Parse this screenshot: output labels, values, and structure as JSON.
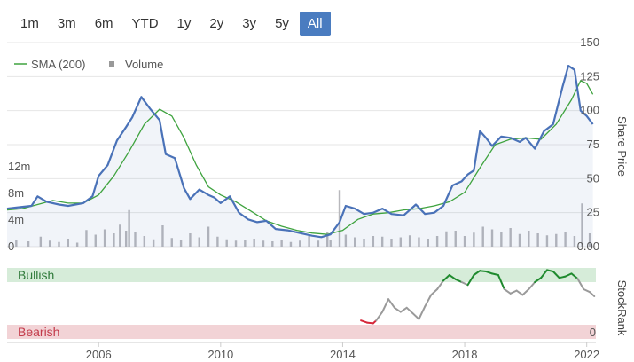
{
  "range_selector": {
    "buttons": [
      "1m",
      "3m",
      "6m",
      "YTD",
      "1y",
      "2y",
      "3y",
      "5y",
      "All"
    ],
    "active": "All"
  },
  "colors": {
    "price": "#4a72b8",
    "sma": "#3fa33f",
    "volume": "#b8b8bc",
    "bullish_band": "#d6ecd9",
    "bearish_band": "#f2d3d6",
    "rank_neutral": "#9a9a9a",
    "rank_bullish": "#1f8a2e",
    "rank_bearish": "#d6283a"
  },
  "chart_data": [
    {
      "type": "line",
      "name": "price-chart",
      "legend": [
        {
          "name": "SMA (200)",
          "kind": "line"
        },
        {
          "name": "Volume",
          "kind": "square"
        }
      ],
      "legend_position": "top-left",
      "ylabel": "Share Price",
      "y_ticks": [
        "0.00",
        "25",
        "50",
        "75",
        "100",
        "125",
        "150"
      ],
      "ylim": [
        0,
        150
      ],
      "vol_ticks": [
        "0",
        "4m",
        "8m",
        "12m"
      ],
      "vol_lim": [
        0,
        16
      ],
      "xlim": [
        2003.0,
        2022.3
      ],
      "x_ticks": [
        "2006",
        "2010",
        "2014",
        "2018",
        "2022"
      ],
      "series": [
        {
          "name": "Share Price",
          "points": [
            [
              2003.0,
              28
            ],
            [
              2003.4,
              29
            ],
            [
              2003.8,
              30
            ],
            [
              2004.0,
              37
            ],
            [
              2004.3,
              33
            ],
            [
              2004.7,
              31
            ],
            [
              2005.0,
              30
            ],
            [
              2005.5,
              32
            ],
            [
              2005.8,
              37
            ],
            [
              2006.0,
              52
            ],
            [
              2006.3,
              60
            ],
            [
              2006.6,
              78
            ],
            [
              2006.9,
              88
            ],
            [
              2007.1,
              95
            ],
            [
              2007.4,
              110
            ],
            [
              2007.7,
              101
            ],
            [
              2008.0,
              93
            ],
            [
              2008.2,
              68
            ],
            [
              2008.5,
              65
            ],
            [
              2008.8,
              43
            ],
            [
              2009.0,
              35
            ],
            [
              2009.3,
              42
            ],
            [
              2009.6,
              38
            ],
            [
              2009.8,
              36
            ],
            [
              2010.0,
              32
            ],
            [
              2010.3,
              37
            ],
            [
              2010.6,
              25
            ],
            [
              2010.9,
              20
            ],
            [
              2011.2,
              18
            ],
            [
              2011.5,
              19
            ],
            [
              2011.8,
              13
            ],
            [
              2012.2,
              12
            ],
            [
              2012.6,
              10
            ],
            [
              2013.0,
              8
            ],
            [
              2013.3,
              7
            ],
            [
              2013.6,
              9
            ],
            [
              2013.9,
              18
            ],
            [
              2014.1,
              30
            ],
            [
              2014.4,
              28
            ],
            [
              2014.7,
              24
            ],
            [
              2015.0,
              25
            ],
            [
              2015.3,
              28
            ],
            [
              2015.6,
              24
            ],
            [
              2016.0,
              23
            ],
            [
              2016.4,
              31
            ],
            [
              2016.7,
              24
            ],
            [
              2017.0,
              25
            ],
            [
              2017.3,
              30
            ],
            [
              2017.6,
              45
            ],
            [
              2017.9,
              48
            ],
            [
              2018.1,
              53
            ],
            [
              2018.3,
              56
            ],
            [
              2018.5,
              85
            ],
            [
              2018.7,
              80
            ],
            [
              2018.9,
              74
            ],
            [
              2019.2,
              81
            ],
            [
              2019.5,
              80
            ],
            [
              2019.8,
              77
            ],
            [
              2020.0,
              80
            ],
            [
              2020.3,
              72
            ],
            [
              2020.6,
              85
            ],
            [
              2020.9,
              90
            ],
            [
              2021.2,
              117
            ],
            [
              2021.4,
              133
            ],
            [
              2021.6,
              130
            ],
            [
              2021.8,
              100
            ],
            [
              2022.0,
              96
            ],
            [
              2022.2,
              90
            ]
          ]
        },
        {
          "name": "SMA (200)",
          "points": [
            [
              2003.0,
              27
            ],
            [
              2003.5,
              28
            ],
            [
              2004.0,
              31
            ],
            [
              2004.5,
              34
            ],
            [
              2005.0,
              32
            ],
            [
              2005.5,
              32
            ],
            [
              2006.0,
              38
            ],
            [
              2006.5,
              52
            ],
            [
              2007.0,
              70
            ],
            [
              2007.5,
              90
            ],
            [
              2008.0,
              101
            ],
            [
              2008.4,
              96
            ],
            [
              2008.8,
              80
            ],
            [
              2009.2,
              60
            ],
            [
              2009.6,
              44
            ],
            [
              2010.0,
              38
            ],
            [
              2010.5,
              33
            ],
            [
              2011.0,
              26
            ],
            [
              2011.5,
              19
            ],
            [
              2012.0,
              15
            ],
            [
              2012.5,
              12
            ],
            [
              2013.0,
              10
            ],
            [
              2013.5,
              9
            ],
            [
              2014.0,
              12
            ],
            [
              2014.5,
              20
            ],
            [
              2015.0,
              24
            ],
            [
              2015.5,
              25
            ],
            [
              2016.0,
              27
            ],
            [
              2016.5,
              28
            ],
            [
              2017.0,
              30
            ],
            [
              2017.5,
              33
            ],
            [
              2018.0,
              40
            ],
            [
              2018.5,
              58
            ],
            [
              2019.0,
              75
            ],
            [
              2019.5,
              79
            ],
            [
              2020.0,
              80
            ],
            [
              2020.5,
              79
            ],
            [
              2021.0,
              90
            ],
            [
              2021.5,
              108
            ],
            [
              2021.8,
              122
            ],
            [
              2022.0,
              120
            ],
            [
              2022.2,
              112
            ]
          ]
        }
      ],
      "volume_bars": [
        [
          2003.3,
          1.0
        ],
        [
          2003.7,
          0.8
        ],
        [
          2004.1,
          1.5
        ],
        [
          2004.4,
          0.9
        ],
        [
          2004.7,
          0.7
        ],
        [
          2005.0,
          1.2
        ],
        [
          2005.3,
          0.6
        ],
        [
          2005.6,
          2.5
        ],
        [
          2005.9,
          1.8
        ],
        [
          2006.2,
          2.6
        ],
        [
          2006.5,
          2.0
        ],
        [
          2006.7,
          3.3
        ],
        [
          2006.9,
          2.4
        ],
        [
          2007.0,
          5.5
        ],
        [
          2007.2,
          2.2
        ],
        [
          2007.5,
          1.6
        ],
        [
          2007.8,
          1.1
        ],
        [
          2008.1,
          3.2
        ],
        [
          2008.4,
          1.3
        ],
        [
          2008.7,
          1.0
        ],
        [
          2009.0,
          2.0
        ],
        [
          2009.3,
          1.4
        ],
        [
          2009.6,
          3.0
        ],
        [
          2009.9,
          1.5
        ],
        [
          2010.2,
          1.1
        ],
        [
          2010.5,
          0.9
        ],
        [
          2010.8,
          1.0
        ],
        [
          2011.1,
          1.2
        ],
        [
          2011.4,
          0.9
        ],
        [
          2011.7,
          0.8
        ],
        [
          2012.0,
          1.0
        ],
        [
          2012.3,
          0.7
        ],
        [
          2012.6,
          0.9
        ],
        [
          2012.9,
          1.6
        ],
        [
          2013.2,
          0.9
        ],
        [
          2013.5,
          2.2
        ],
        [
          2013.6,
          1.0
        ],
        [
          2013.9,
          8.5
        ],
        [
          2014.1,
          1.8
        ],
        [
          2014.4,
          1.4
        ],
        [
          2014.7,
          1.2
        ],
        [
          2015.0,
          1.6
        ],
        [
          2015.3,
          1.5
        ],
        [
          2015.6,
          1.2
        ],
        [
          2015.9,
          1.4
        ],
        [
          2016.2,
          1.7
        ],
        [
          2016.5,
          1.4
        ],
        [
          2016.8,
          1.2
        ],
        [
          2017.1,
          1.6
        ],
        [
          2017.4,
          2.3
        ],
        [
          2017.7,
          2.4
        ],
        [
          2018.0,
          1.6
        ],
        [
          2018.3,
          2.1
        ],
        [
          2018.6,
          3.0
        ],
        [
          2018.9,
          2.6
        ],
        [
          2019.2,
          2.2
        ],
        [
          2019.5,
          2.8
        ],
        [
          2019.8,
          1.9
        ],
        [
          2020.1,
          2.4
        ],
        [
          2020.4,
          2.0
        ],
        [
          2020.7,
          1.7
        ],
        [
          2021.0,
          1.9
        ],
        [
          2021.3,
          2.2
        ],
        [
          2021.6,
          1.6
        ],
        [
          2021.85,
          6.5
        ],
        [
          2022.1,
          2.0
        ]
      ]
    },
    {
      "type": "line",
      "name": "stockrank-chart",
      "ylabel": "StockRank",
      "y_ticks": [
        "0"
      ],
      "ylim": [
        0,
        100
      ],
      "zones": [
        {
          "label": "Bullish",
          "range": [
            80,
            100
          ]
        },
        {
          "label": "Bearish",
          "range": [
            0,
            20
          ]
        }
      ],
      "series": [
        {
          "name": "StockRank",
          "points": [
            [
              2014.6,
              26
            ],
            [
              2014.8,
              23
            ],
            [
              2015.0,
              22
            ],
            [
              2015.1,
              26
            ],
            [
              2015.3,
              38
            ],
            [
              2015.5,
              56
            ],
            [
              2015.7,
              44
            ],
            [
              2015.9,
              38
            ],
            [
              2016.1,
              44
            ],
            [
              2016.3,
              36
            ],
            [
              2016.5,
              28
            ],
            [
              2016.7,
              46
            ],
            [
              2016.9,
              62
            ],
            [
              2017.1,
              70
            ],
            [
              2017.3,
              82
            ],
            [
              2017.5,
              90
            ],
            [
              2017.7,
              84
            ],
            [
              2017.9,
              80
            ],
            [
              2018.1,
              76
            ],
            [
              2018.3,
              90
            ],
            [
              2018.5,
              96
            ],
            [
              2018.7,
              95
            ],
            [
              2018.9,
              92
            ],
            [
              2019.1,
              90
            ],
            [
              2019.3,
              70
            ],
            [
              2019.5,
              64
            ],
            [
              2019.7,
              68
            ],
            [
              2019.9,
              62
            ],
            [
              2020.1,
              70
            ],
            [
              2020.3,
              80
            ],
            [
              2020.5,
              86
            ],
            [
              2020.7,
              97
            ],
            [
              2020.9,
              95
            ],
            [
              2021.1,
              86
            ],
            [
              2021.3,
              88
            ],
            [
              2021.5,
              92
            ],
            [
              2021.7,
              85
            ],
            [
              2021.9,
              70
            ],
            [
              2022.1,
              66
            ],
            [
              2022.25,
              60
            ]
          ]
        }
      ]
    }
  ]
}
